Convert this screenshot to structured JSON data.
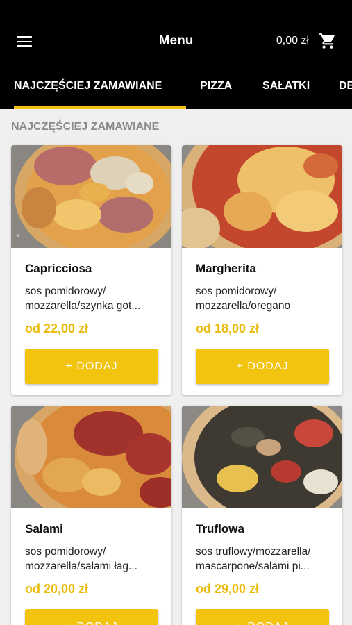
{
  "header": {
    "menu_icon": "hamburger-menu-icon",
    "title": "Menu",
    "cart_total": "0,00 zł",
    "cart_icon": "shopping-cart-icon"
  },
  "tabs": [
    {
      "label": "NAJCZĘŚCIEJ ZAMAWIANE",
      "active": true
    },
    {
      "label": "PIZZA",
      "active": false
    },
    {
      "label": "SAŁATKI",
      "active": false
    },
    {
      "label": "DESERY",
      "active": false
    }
  ],
  "section": {
    "title": "NAJCZĘŚCIEJ ZAMAWIANE"
  },
  "products": [
    {
      "name": "Capricciosa",
      "description": "sos pomidorowy/ mozzarella/szynka got...",
      "price": "od 22,00 zł",
      "button_label": "+ DODAJ",
      "image": "capricciosa-pizza-photo"
    },
    {
      "name": "Margherita",
      "description": "sos pomidorowy/ mozzarella/oregano",
      "price": "od 18,00 zł",
      "button_label": "+ DODAJ",
      "image": "margherita-pizza-photo"
    },
    {
      "name": "Salami",
      "description": "sos pomidorowy/ mozzarella/salami łag...",
      "price": "od 20,00 zł",
      "button_label": "+ DODAJ",
      "image": "salami-pizza-photo"
    },
    {
      "name": "Truflowa",
      "description": "sos truflowy/mozzarella/ mascarpone/salami pi...",
      "price": "od 29,00 zł",
      "button_label": "+ DODAJ",
      "image": "truflowa-pizza-photo"
    }
  ],
  "colors": {
    "accent": "#f2c40f",
    "price": "#eabb0a",
    "header_bg": "#000000",
    "page_bg": "#efefef"
  }
}
